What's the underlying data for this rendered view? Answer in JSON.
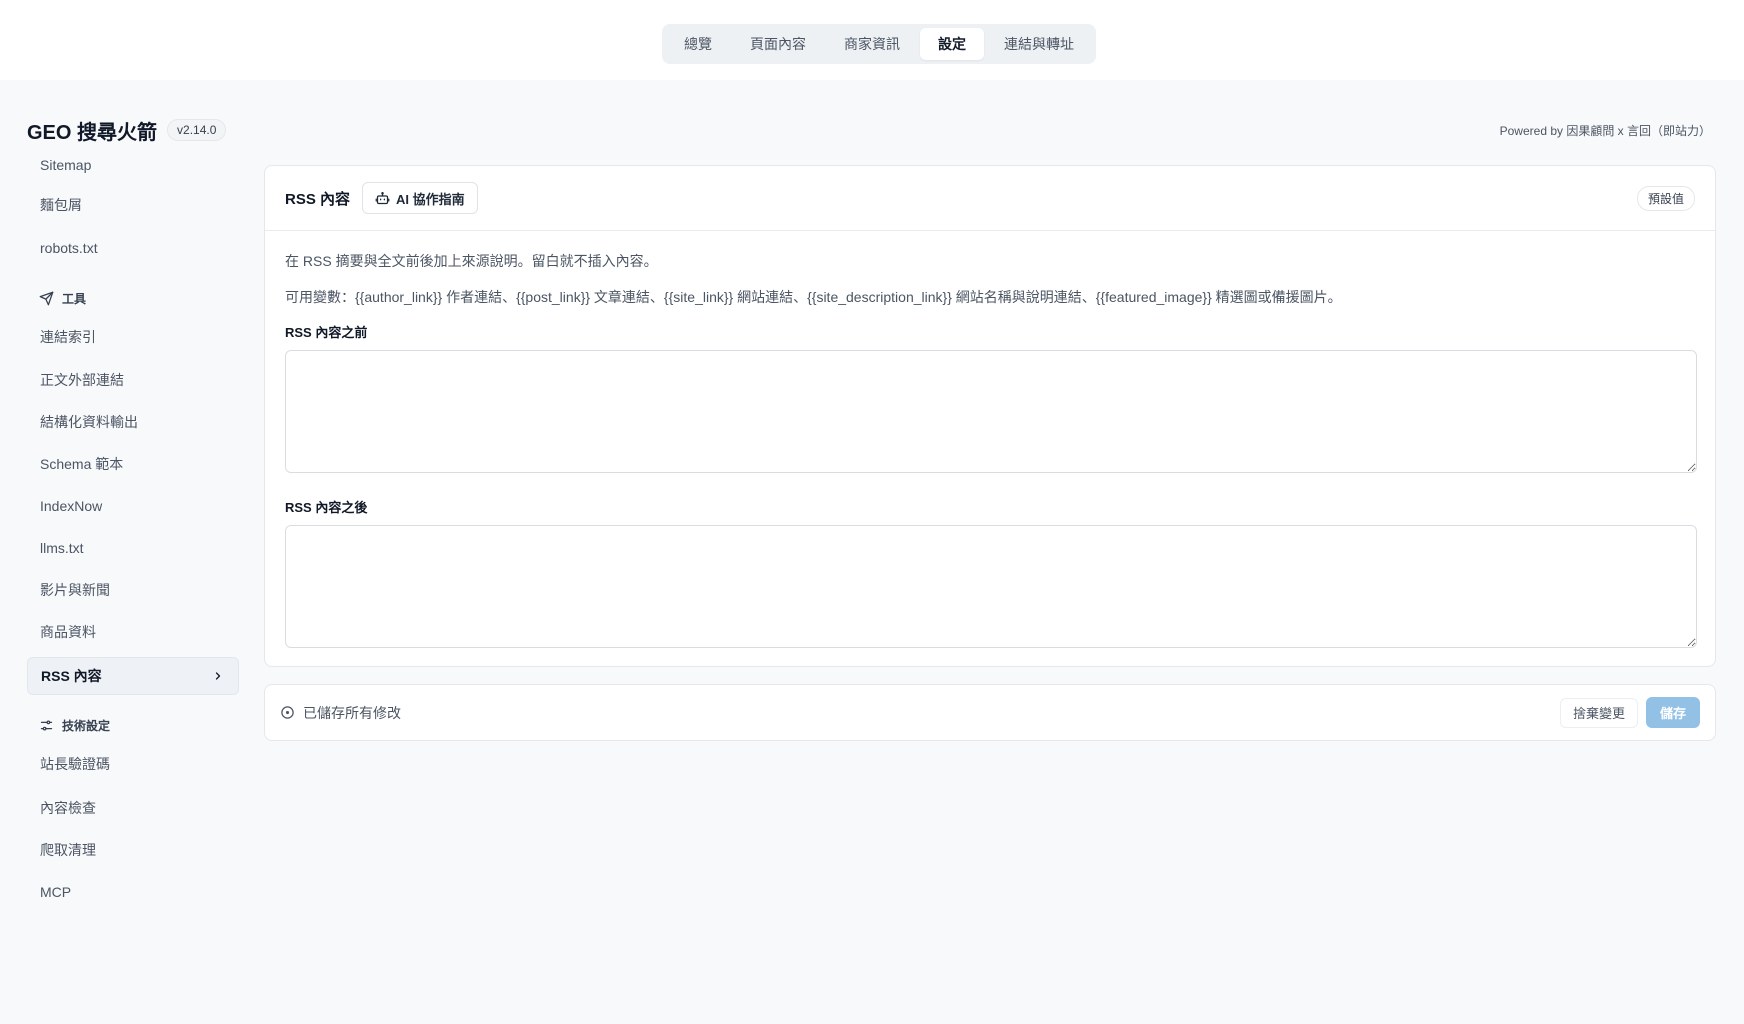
{
  "top_tabs": [
    {
      "label": "總覽"
    },
    {
      "label": "頁面內容"
    },
    {
      "label": "商家資訊"
    },
    {
      "label": "設定",
      "active": true
    },
    {
      "label": "連結與轉址"
    }
  ],
  "header": {
    "app_name": "GEO 搜尋火箭",
    "version": "v2.14.0",
    "powered_by": "Powered by 因果顧問 x 言回（即站力）"
  },
  "sidebar": {
    "items_top": [
      {
        "label": "Sitemap"
      },
      {
        "label": "麵包屑"
      },
      {
        "label": "robots.txt"
      }
    ],
    "tools_group": {
      "label": "工具",
      "icon": "send-icon"
    },
    "tools_items": [
      {
        "label": "連結索引"
      },
      {
        "label": "正文外部連結"
      },
      {
        "label": "結構化資料輸出"
      },
      {
        "label": "Schema 範本"
      },
      {
        "label": "IndexNow"
      },
      {
        "label": "llms.txt"
      },
      {
        "label": "影片與新聞"
      },
      {
        "label": "商品資料"
      },
      {
        "label": "RSS 內容",
        "active": true
      }
    ],
    "tech_group": {
      "label": "技術設定",
      "icon": "sliders-icon"
    },
    "tech_items": [
      {
        "label": "站長驗證碼"
      },
      {
        "label": "內容檢查"
      },
      {
        "label": "爬取清理"
      },
      {
        "label": "MCP"
      }
    ]
  },
  "card": {
    "title": "RSS 內容",
    "guide_label": "AI 協作指南",
    "default_label": "預設值",
    "desc1": "在 RSS 摘要與全文前後加上來源說明。留白就不插入內容。",
    "desc2": "可用變數：{{author_link}} 作者連結、{{post_link}} 文章連結、{{site_link}} 網站連結、{{site_description_link}} 網站名稱與說明連結、{{featured_image}} 精選圖或備援圖片。",
    "before_label": "RSS 內容之前",
    "before_value": "",
    "after_label": "RSS 內容之後",
    "after_value": ""
  },
  "savebar": {
    "status": "已儲存所有修改",
    "discard_label": "捨棄變更",
    "save_label": "儲存"
  },
  "colors": {
    "accent": "#93c1e6",
    "active_nav_bg": "#eef1f5",
    "page_bg": "#f8f9fb"
  }
}
